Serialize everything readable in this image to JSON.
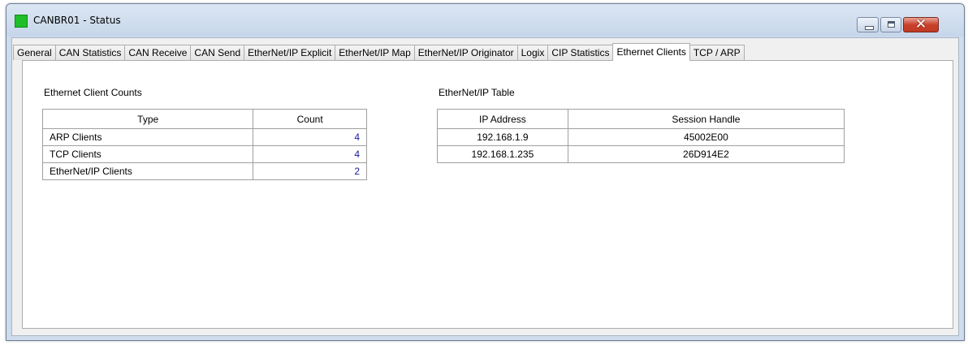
{
  "window": {
    "title": "CANBR01 - Status",
    "controls": {
      "minimize": "minimize",
      "maximize": "maximize",
      "close": "✕"
    }
  },
  "tabs": [
    {
      "label": "General"
    },
    {
      "label": "CAN Statistics"
    },
    {
      "label": "CAN Receive"
    },
    {
      "label": "CAN Send"
    },
    {
      "label": "EtherNet/IP Explicit"
    },
    {
      "label": "EtherNet/IP Map"
    },
    {
      "label": "EtherNet/IP Originator"
    },
    {
      "label": "Logix"
    },
    {
      "label": "CIP Statistics"
    },
    {
      "label": "Ethernet Clients",
      "active": true
    },
    {
      "label": "TCP / ARP"
    }
  ],
  "client_counts": {
    "title": "Ethernet Client Counts",
    "headers": [
      "Type",
      "Count"
    ],
    "rows": [
      [
        "ARP Clients",
        "4"
      ],
      [
        "TCP Clients",
        "4"
      ],
      [
        "EtherNet/IP Clients",
        "2"
      ]
    ]
  },
  "enip_table": {
    "title": "EtherNet/IP Table",
    "headers": [
      "IP Address",
      "Session Handle"
    ],
    "rows": [
      [
        "192.168.1.9",
        "45002E00"
      ],
      [
        "192.168.1.235",
        "26D914E2"
      ]
    ]
  },
  "colors": {
    "app_icon": "#1fbf2a",
    "count_text": "#1a1aa0",
    "close_button": "#c9412c"
  }
}
